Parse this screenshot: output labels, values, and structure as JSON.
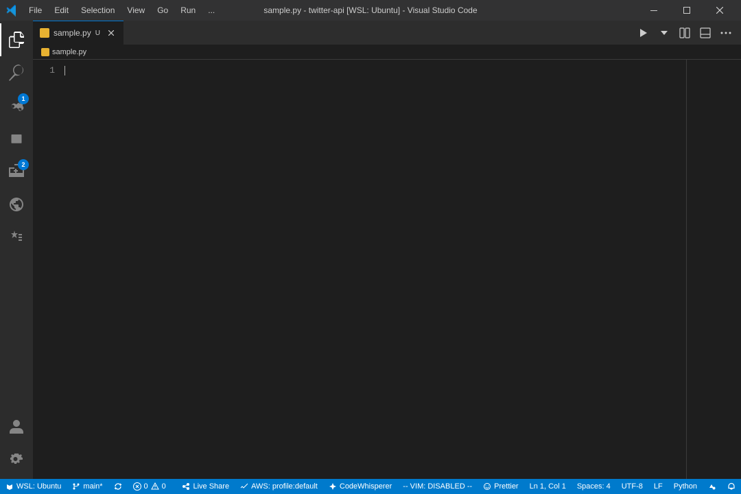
{
  "titleBar": {
    "title": "sample.py - twitter-api [WSL: Ubuntu] - Visual Studio Code",
    "menuItems": [
      "File",
      "Edit",
      "Selection",
      "View",
      "Go",
      "Run",
      "..."
    ],
    "windowControls": {
      "minimize": "─",
      "maximize": "□",
      "close": "✕"
    }
  },
  "activityBar": {
    "items": [
      {
        "name": "explorer",
        "badge": null
      },
      {
        "name": "search",
        "badge": null
      },
      {
        "name": "source-control",
        "badge": "1"
      },
      {
        "name": "run-debug",
        "badge": null
      },
      {
        "name": "extensions",
        "badge": "2"
      },
      {
        "name": "remote-explorer",
        "badge": null
      },
      {
        "name": "testing",
        "badge": null
      }
    ],
    "bottomItems": [
      {
        "name": "accounts"
      },
      {
        "name": "settings"
      }
    ]
  },
  "tabs": [
    {
      "filename": "sample.py",
      "modified": true,
      "active": true,
      "modifiedLabel": "U"
    }
  ],
  "breadcrumb": {
    "filename": "sample.py"
  },
  "editor": {
    "lines": [
      "1"
    ],
    "content": ""
  },
  "statusBar": {
    "wsl": "WSL: Ubuntu",
    "branch": "main*",
    "sync": "",
    "errors": "0",
    "warnings": "0",
    "liveShare": "Live Share",
    "aws": "AWS: profile:default",
    "codeWhisperer": "CodeWhisperer",
    "vim": "-- VIM: DISABLED --",
    "prettier": "Prettier",
    "encoding": ""
  }
}
